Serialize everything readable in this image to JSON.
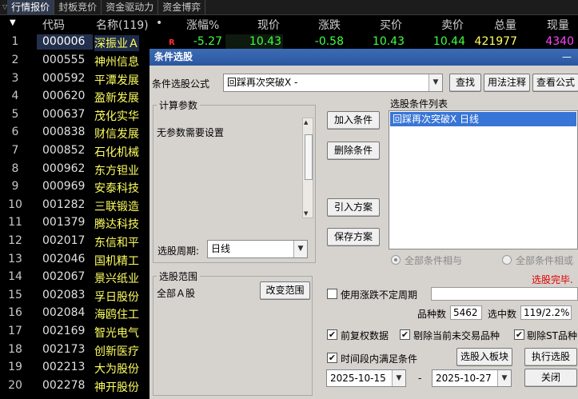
{
  "tabs": {
    "caret": "▽",
    "items": [
      "行情报价",
      "封板竞价",
      "资金驱动力",
      "资金博弈"
    ]
  },
  "header": {
    "sort_marker": "▼",
    "code": "代码",
    "name": "名称(119)",
    "dot": "•",
    "pct": "涨幅%",
    "price": "现价",
    "change": "涨跌",
    "bid": "买价",
    "ask": "卖价",
    "volume": "总量",
    "cur": "现量"
  },
  "first_row": {
    "idx": "1",
    "code": "000006",
    "name": "深振业Ａ",
    "flag": "R",
    "pct": "-5.27",
    "price": "10.43",
    "change": "-0.58",
    "bid": "10.43",
    "ask": "10.44",
    "volume": "421977",
    "cur": "4340"
  },
  "rows": [
    {
      "idx": "2",
      "code": "000555",
      "name": "神州信息"
    },
    {
      "idx": "3",
      "code": "000592",
      "name": "平潭发展"
    },
    {
      "idx": "4",
      "code": "000620",
      "name": "盈新发展"
    },
    {
      "idx": "5",
      "code": "000637",
      "name": "茂化实华"
    },
    {
      "idx": "6",
      "code": "000838",
      "name": "财信发展"
    },
    {
      "idx": "7",
      "code": "000852",
      "name": "石化机械"
    },
    {
      "idx": "8",
      "code": "000962",
      "name": "东方钽业"
    },
    {
      "idx": "9",
      "code": "000969",
      "name": "安泰科技"
    },
    {
      "idx": "10",
      "code": "001282",
      "name": "三联锻造"
    },
    {
      "idx": "11",
      "code": "001379",
      "name": "腾达科技"
    },
    {
      "idx": "12",
      "code": "002017",
      "name": "东信和平"
    },
    {
      "idx": "13",
      "code": "002046",
      "name": "国机精工"
    },
    {
      "idx": "14",
      "code": "002067",
      "name": "景兴纸业"
    },
    {
      "idx": "15",
      "code": "002083",
      "name": "孚日股份"
    },
    {
      "idx": "16",
      "code": "002084",
      "name": "海鸥住工"
    },
    {
      "idx": "17",
      "code": "002169",
      "name": "智光电气"
    },
    {
      "idx": "18",
      "code": "002173",
      "name": "创新医疗"
    },
    {
      "idx": "19",
      "code": "002213",
      "name": "大为股份"
    },
    {
      "idx": "20",
      "code": "002278",
      "name": "神开股份"
    }
  ],
  "dialog": {
    "title": "条件选股",
    "close": "—",
    "formula_label": "条件选股公式",
    "formula_value": "回踩再次突破X  -",
    "btn_find": "查找",
    "btn_usage": "用法注释",
    "btn_view": "查看公式",
    "params_title": "计算参数",
    "params_text": "无参数需要设置",
    "period_label": "选股周期:",
    "period_value": "日线",
    "btn_add": "加入条件",
    "btn_del": "删除条件",
    "btn_import": "引入方案",
    "btn_save": "保存方案",
    "cond_list_title": "选股条件列表",
    "cond_item": "回踩再次突破X  日线",
    "radio_and": "全部条件相与",
    "radio_or": "全部条件相或",
    "status": "选股完毕.",
    "range_title": "选股范围",
    "range_value": "全部Ａ股",
    "btn_range": "改变范围",
    "chk_period": "使用涨跌不定周期",
    "count_label": "品种数",
    "count_value": "5462",
    "selected_label": "选中数",
    "selected_value": "119/2.2%",
    "chk_adjust": "前复权数据",
    "chk_exclude_untraded": "剔除当前未交易品种",
    "chk_exclude_st": "剔除ST品种",
    "chk_timerange": "时间段内满足条件",
    "btn_to_block": "选股入板块",
    "btn_run": "执行选股",
    "date_from": "2025-10-15",
    "date_sep": "-",
    "date_to": "2025-10-27",
    "btn_close": "关闭"
  },
  "colors": {
    "up": "#ff4040",
    "down": "#40ff40",
    "yellow": "#ffff60",
    "pink": "#ff40ff",
    "status": "#e00000"
  }
}
